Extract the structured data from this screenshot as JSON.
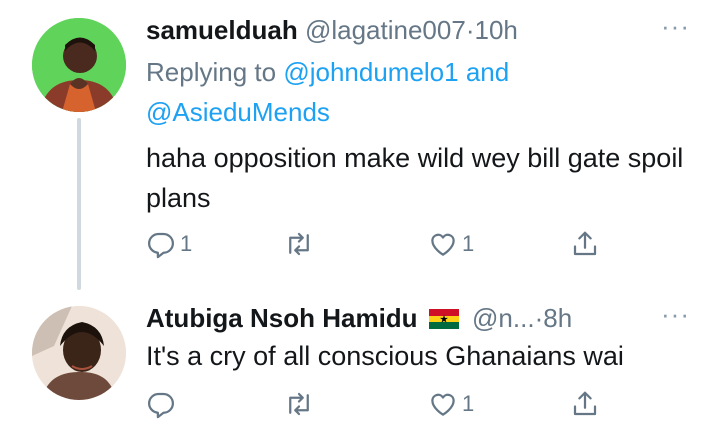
{
  "tweets": [
    {
      "name": "samuelduah",
      "handle": "@lagatine007",
      "dot": "·",
      "time": "10h",
      "more": "···",
      "replying_prefix": "Replying to ",
      "replying_mention1": "@johndumelo1",
      "replying_and": " and",
      "replying_mention2": "@AsieduMends",
      "text": "haha opposition make wild wey bill gate spoil plans",
      "actions": {
        "reply_count": "1",
        "retweet_count": "",
        "like_count": "1"
      }
    },
    {
      "name": "Atubiga Nsoh Hamidu",
      "flag_icon": "ghana-flag-icon",
      "handle": "@n...",
      "dot": "·",
      "time": "8h",
      "more": "···",
      "text": "It's a cry of all conscious Ghanaians wai",
      "actions": {
        "reply_count": "",
        "retweet_count": "",
        "like_count": "1"
      }
    }
  ],
  "colors": {
    "link": "#1da1f2",
    "secondary_text": "#657786",
    "thread_line": "#cfd9de",
    "ghana_red": "#ce1126",
    "ghana_gold": "#fcd116",
    "ghana_green": "#006b3f"
  }
}
